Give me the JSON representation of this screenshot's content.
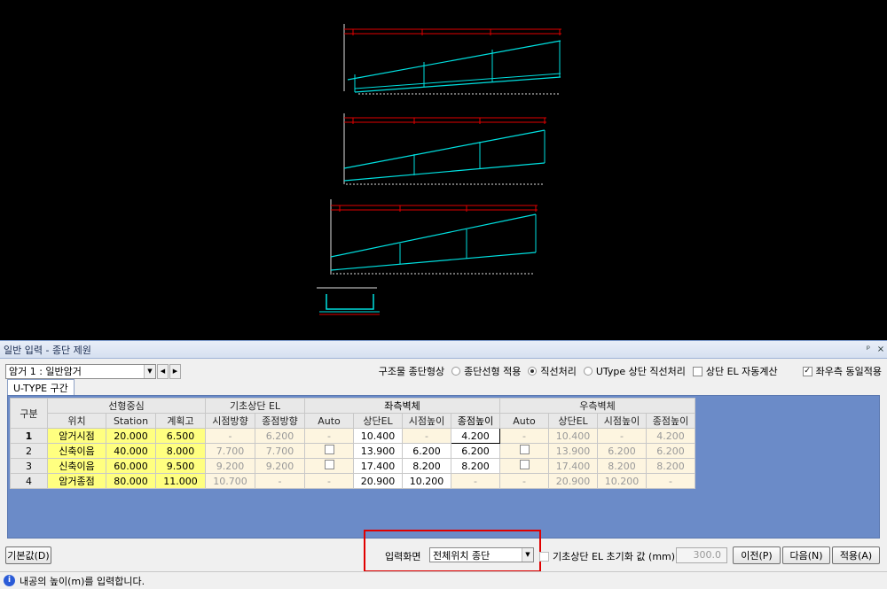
{
  "panel_title": "일반 입력 - 종단 제원",
  "title_controls": {
    "pin": "ᵖ",
    "close": "×"
  },
  "culvert_select": {
    "value": "암거 1 : 일반암거"
  },
  "shape": {
    "label": "구조물 종단형상",
    "options": [
      {
        "label": "종단선형 적용",
        "checked": false
      },
      {
        "label": "직선처리",
        "checked": true
      },
      {
        "label": "UType 상단 직선처리",
        "checked": false
      }
    ],
    "auto_el": {
      "label": "상단 EL 자동계산",
      "checked": false
    },
    "same_lr": {
      "label": "좌우측 동일적용",
      "checked": true
    }
  },
  "tab_label": "U-TYPE 구간",
  "grid": {
    "group_headers": {
      "row_header": "구분",
      "alignment": "선형중심",
      "found_el": "기초상단 EL",
      "left_wall": "좌측벽체",
      "right_wall": "우측벽체"
    },
    "sub_headers": [
      "위치",
      "Station",
      "계획고",
      "시점방향",
      "종점방향",
      "Auto",
      "상단EL",
      "시점높이",
      "종점높이",
      "Auto",
      "상단EL",
      "시점높이",
      "종점높이"
    ],
    "rows": [
      {
        "no": "1",
        "pos": "암거시점",
        "station": "20.000",
        "plan": "6.500",
        "f_start": "-",
        "f_end": "6.200",
        "l_auto": "-",
        "l_top": "10.400",
        "l_sh": "-",
        "l_eh": "4.200",
        "r_auto": "-",
        "r_top": "10.400",
        "r_sh": "-",
        "r_eh": "4.200"
      },
      {
        "no": "2",
        "pos": "신축이음",
        "station": "40.000",
        "plan": "8.000",
        "f_start": "7.700",
        "f_end": "7.700",
        "l_auto": "",
        "l_top": "13.900",
        "l_sh": "6.200",
        "l_eh": "6.200",
        "r_auto": "",
        "r_top": "13.900",
        "r_sh": "6.200",
        "r_eh": "6.200"
      },
      {
        "no": "3",
        "pos": "신축이음",
        "station": "60.000",
        "plan": "9.500",
        "f_start": "9.200",
        "f_end": "9.200",
        "l_auto": "",
        "l_top": "17.400",
        "l_sh": "8.200",
        "l_eh": "8.200",
        "r_auto": "",
        "r_top": "17.400",
        "r_sh": "8.200",
        "r_eh": "8.200"
      },
      {
        "no": "4",
        "pos": "암거종점",
        "station": "80.000",
        "plan": "11.000",
        "f_start": "10.700",
        "f_end": "-",
        "l_auto": "-",
        "l_top": "20.900",
        "l_sh": "10.200",
        "l_eh": "-",
        "r_auto": "-",
        "r_top": "20.900",
        "r_sh": "10.200",
        "r_eh": "-"
      }
    ]
  },
  "bottom": {
    "default_btn": "기본값(D)",
    "input_view_label": "입력화면",
    "input_view_value": "전체위치 종단",
    "reset_label": "기초상단 EL 초기화 값 (mm)",
    "reset_value": "300.0",
    "prev_btn": "이전(P)",
    "next_btn": "다음(N)",
    "apply_btn": "적용(A)"
  },
  "status_text": "내공의 높이(m)를 입력합니다.",
  "colors": {
    "accent_red": "#e00000",
    "grid_bg": "#6b8bc8",
    "yellow_cell": "#ffff80",
    "cad_cyan": "#00e0e0",
    "cad_red": "#e00000"
  }
}
